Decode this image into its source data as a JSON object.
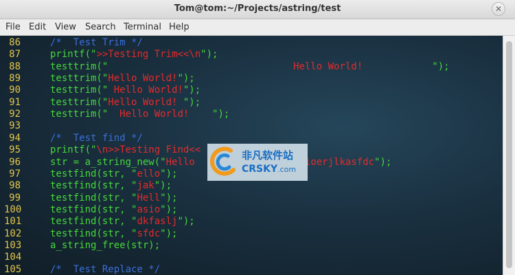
{
  "window": {
    "title": "Tom@tom:~/Projects/astring/test",
    "close_glyph": "✕"
  },
  "menu": [
    "File",
    "Edit",
    "View",
    "Search",
    "Terminal",
    "Help"
  ],
  "lines": [
    {
      "n": "86",
      "segs": [
        [
          "b",
          "/*  Test Trim */"
        ]
      ]
    },
    {
      "n": "87",
      "segs": [
        [
          "g",
          "printf(\""
        ],
        [
          "r",
          ">>Testing Trim<<\\n"
        ],
        [
          "g",
          "\");"
        ]
      ]
    },
    {
      "n": "88",
      "segs": [
        [
          "g",
          "testtrim(\""
        ],
        [
          "r",
          "                                Hello World!            "
        ],
        [
          "g",
          "\");"
        ]
      ]
    },
    {
      "n": "89",
      "segs": [
        [
          "g",
          "testtrim(\""
        ],
        [
          "r",
          "Hello World!"
        ],
        [
          "g",
          "\");"
        ]
      ]
    },
    {
      "n": "90",
      "segs": [
        [
          "g",
          "testtrim(\""
        ],
        [
          "r",
          " Hello World!"
        ],
        [
          "g",
          "\");"
        ]
      ]
    },
    {
      "n": "91",
      "segs": [
        [
          "g",
          "testtrim(\""
        ],
        [
          "r",
          "Hello World! "
        ],
        [
          "g",
          "\");"
        ]
      ]
    },
    {
      "n": "92",
      "segs": [
        [
          "g",
          "testtrim(\""
        ],
        [
          "r",
          "  Hello World!    "
        ],
        [
          "g",
          "\");"
        ]
      ]
    },
    {
      "n": "93",
      "segs": []
    },
    {
      "n": "94",
      "segs": [
        [
          "b",
          "/*  Test find */"
        ]
      ]
    },
    {
      "n": "95",
      "segs": [
        [
          "g",
          "printf(\""
        ],
        [
          "r",
          "\\n>>Testing Find<<"
        ]
      ]
    },
    {
      "n": "96",
      "segs": [
        [
          "g",
          "str = a_string_new(\""
        ],
        [
          "r",
          "Hello"
        ],
        [
          "g",
          "                   "
        ],
        [
          "r",
          "ioerjlkasfdc"
        ],
        [
          "g",
          "\");"
        ]
      ]
    },
    {
      "n": "97",
      "segs": [
        [
          "g",
          "testfind(str, \""
        ],
        [
          "r",
          "ello"
        ],
        [
          "g",
          "\");"
        ]
      ]
    },
    {
      "n": "98",
      "segs": [
        [
          "g",
          "testfind(str, \""
        ],
        [
          "r",
          "jak"
        ],
        [
          "g",
          "\");"
        ]
      ]
    },
    {
      "n": "99",
      "segs": [
        [
          "g",
          "testfind(str, \""
        ],
        [
          "r",
          "Hell"
        ],
        [
          "g",
          "\");"
        ]
      ]
    },
    {
      "n": "100",
      "segs": [
        [
          "g",
          "testfind(str, \""
        ],
        [
          "r",
          "asio"
        ],
        [
          "g",
          "\");"
        ]
      ]
    },
    {
      "n": "101",
      "segs": [
        [
          "g",
          "testfind(str, \""
        ],
        [
          "r",
          "dkfaslj"
        ],
        [
          "g",
          "\");"
        ]
      ]
    },
    {
      "n": "102",
      "segs": [
        [
          "g",
          "testfind(str, \""
        ],
        [
          "r",
          "sfdc"
        ],
        [
          "g",
          "\");"
        ]
      ]
    },
    {
      "n": "103",
      "segs": [
        [
          "g",
          "a_string_free(str);"
        ]
      ]
    },
    {
      "n": "104",
      "segs": []
    },
    {
      "n": "105",
      "segs": [
        [
          "b",
          "/*  Test Replace */"
        ]
      ]
    }
  ],
  "watermark": {
    "cn": "非凡软件站",
    "en": "CRSKY",
    "domain": ".com"
  },
  "colors": {
    "code_green": "#46d83a",
    "string_red": "#e42b2b",
    "comment_blue": "#3b6fd8",
    "line_number_yellow": "#e4c74a"
  }
}
